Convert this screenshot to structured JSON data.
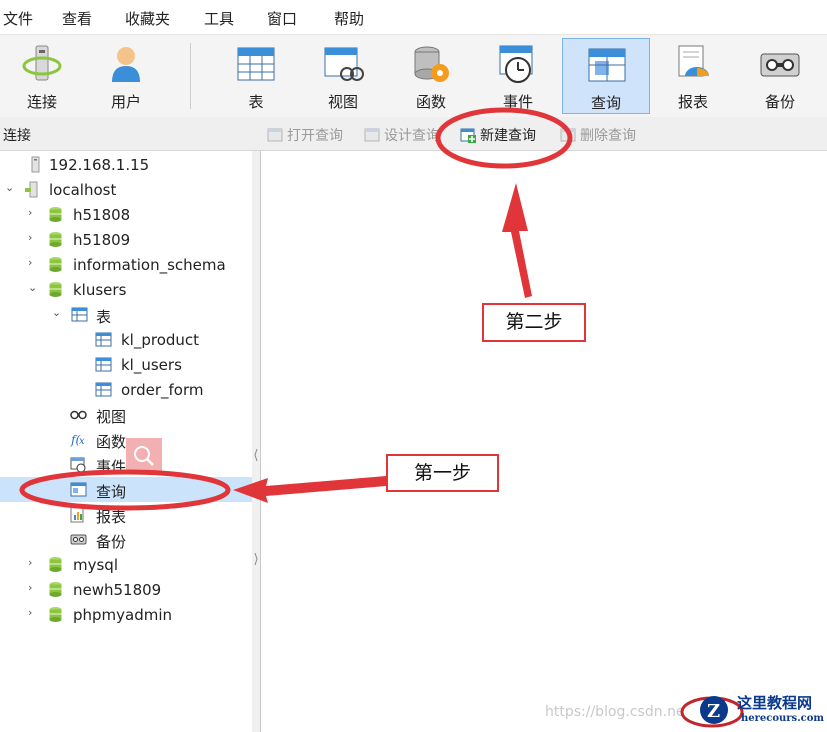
{
  "menubar": {
    "items": [
      "文件",
      "查看",
      "收藏夹",
      "工具",
      "窗口",
      "帮助"
    ]
  },
  "toolbar": {
    "buttons": [
      {
        "label": "连接",
        "icon": "connection-icon"
      },
      {
        "label": "用户",
        "icon": "user-icon"
      },
      {
        "label": "表",
        "icon": "table-icon"
      },
      {
        "label": "视图",
        "icon": "view-icon"
      },
      {
        "label": "函数",
        "icon": "function-icon"
      },
      {
        "label": "事件",
        "icon": "event-icon"
      },
      {
        "label": "查询",
        "icon": "query-icon",
        "active": true
      },
      {
        "label": "报表",
        "icon": "report-icon"
      },
      {
        "label": "备份",
        "icon": "backup-icon"
      }
    ]
  },
  "subbar": {
    "connection_label": "连接",
    "actions": [
      {
        "label": "打开查询",
        "enabled": false
      },
      {
        "label": "设计查询",
        "enabled": false
      },
      {
        "label": "新建查询",
        "enabled": true
      },
      {
        "label": "删除查询",
        "enabled": false
      }
    ]
  },
  "tree": {
    "items": [
      {
        "label": "192.168.1.15",
        "icon": "server-icon"
      },
      {
        "label": "localhost",
        "icon": "server-icon",
        "expanded": true
      },
      {
        "label": "h51808",
        "icon": "database-icon"
      },
      {
        "label": "h51809",
        "icon": "database-icon"
      },
      {
        "label": "information_schema",
        "icon": "database-icon"
      },
      {
        "label": "klusers",
        "icon": "database-icon",
        "expanded": true
      },
      {
        "label": "表",
        "icon": "table-icon",
        "expanded": true
      },
      {
        "label": "kl_product",
        "icon": "table-icon"
      },
      {
        "label": "kl_users",
        "icon": "table-icon"
      },
      {
        "label": "order_form",
        "icon": "table-icon"
      },
      {
        "label": "视图",
        "icon": "view-icon"
      },
      {
        "label": "函数",
        "icon": "function-icon"
      },
      {
        "label": "事件",
        "icon": "event-icon"
      },
      {
        "label": "查询",
        "icon": "query-icon",
        "selected": true
      },
      {
        "label": "报表",
        "icon": "report-icon"
      },
      {
        "label": "备份",
        "icon": "backup-icon"
      },
      {
        "label": "mysql",
        "icon": "database-icon"
      },
      {
        "label": "newh51809",
        "icon": "database-icon"
      },
      {
        "label": "phpmyadmin",
        "icon": "database-icon"
      }
    ]
  },
  "annotations": {
    "step1": "第一步",
    "step2": "第二步"
  },
  "watermark": "https://blog.csdn.ne",
  "logo": {
    "title": "这里教程网",
    "domain": "herecours.com"
  },
  "colors": {
    "annotation_red": "#e0363a",
    "selected_bg": "#cce4fb",
    "active_button_bg": "#cfe3fb",
    "database_green": "#8cc63f",
    "logo_blue": "#0b3a8c"
  }
}
